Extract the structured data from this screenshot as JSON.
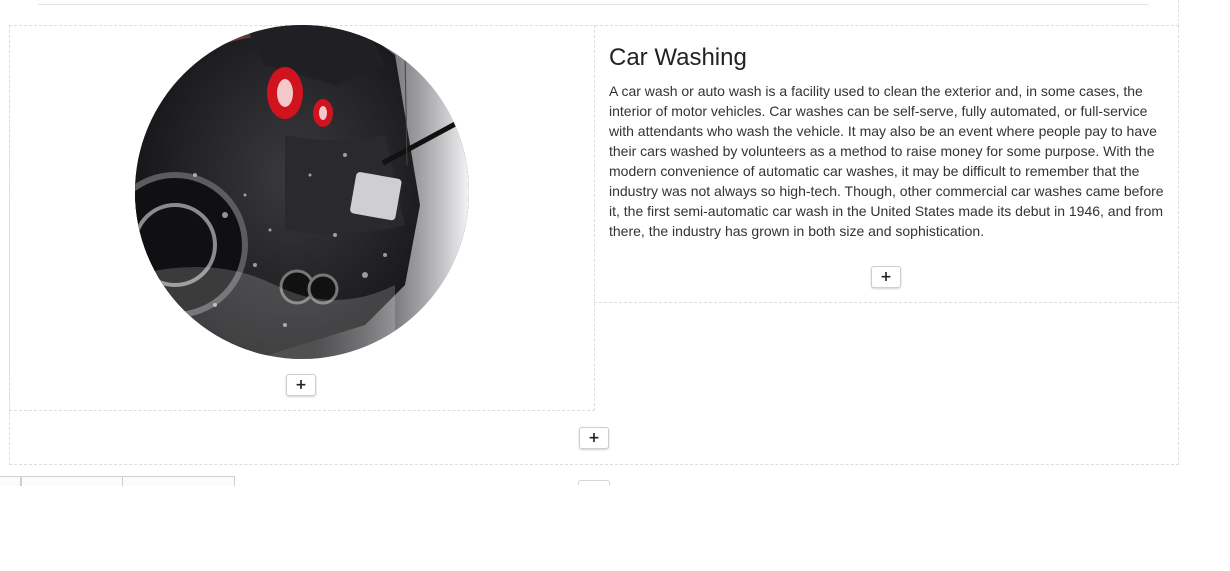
{
  "section": {
    "title": "Car Washing",
    "body": "A car wash or auto wash is a facility used to clean the exterior and, in some cases, the interior of motor vehicles. Car washes can be self-serve, fully automated, or full-service with attendants who wash the vehicle. It may also be an event where people pay to have their cars washed by volunteers as a method to raise money for some purpose. With the modern convenience of automatic car washes, it may be difficult to remember that the industry was not always so high-tech. Though, other commercial car washes came before it, the first semi-automatic car wash in the United States made its debut in 1946, and from there, the industry has grown in both size and sophistication."
  },
  "image": {
    "subject": "car-wash-photo"
  },
  "buttons": {
    "add_label": "+"
  },
  "colors": {
    "border_dashed": "#dddddd",
    "text": "#333333",
    "title": "#222222",
    "taillight": "#d0131f"
  }
}
